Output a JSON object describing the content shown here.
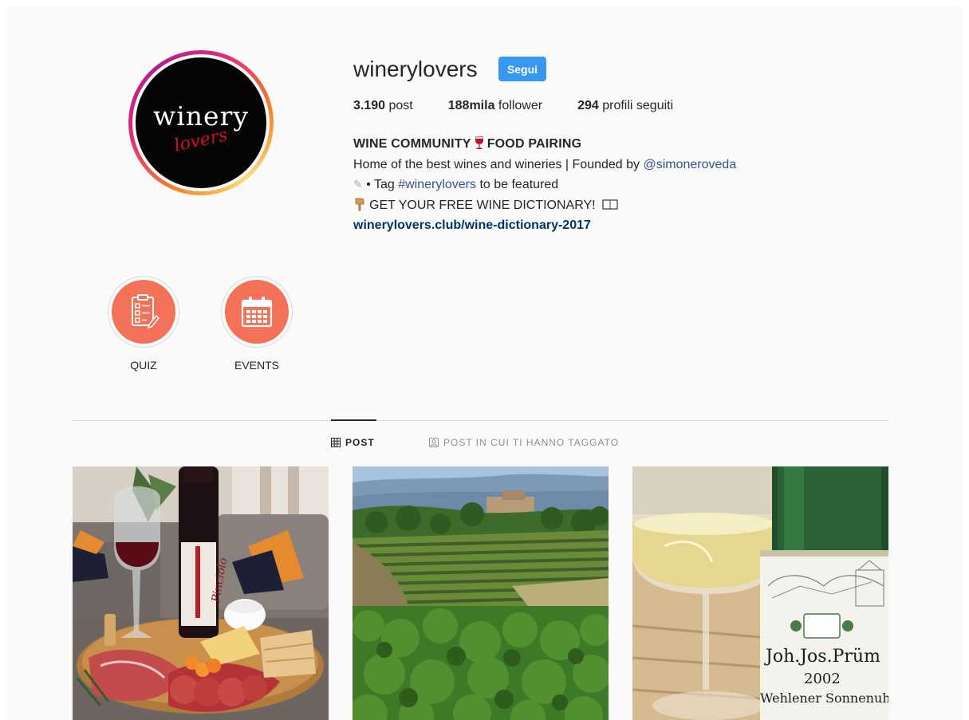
{
  "profile": {
    "username": "winerylovers",
    "follow_label": "Segui",
    "logo_text_top": "winery",
    "logo_text_bottom": "lovers",
    "stats": {
      "posts_value": "3.190",
      "posts_label": "post",
      "followers_value": "188mila",
      "followers_label": "follower",
      "following_value": "294",
      "following_label": "profili seguiti"
    },
    "bio": {
      "name_part1": "WINE COMMUNITY",
      "name_part2": "FOOD PAIRING",
      "line1_text": "Home of the best wines and wineries | Founded by ",
      "line1_mention": "@simoneroveda",
      "line2_prefix": "• Tag ",
      "line2_hashtag": "#winerylovers",
      "line2_suffix": " to be featured",
      "line3_text": "GET YOUR FREE WINE DICTIONARY!",
      "website": "winerylovers.club/wine-dictionary-2017"
    }
  },
  "highlights": [
    {
      "label": "QUIZ",
      "icon": "quiz-document-icon"
    },
    {
      "label": "EVENTS",
      "icon": "calendar-icon"
    }
  ],
  "tabs": {
    "posts_label": "POST",
    "tagged_label": "POST IN CUI TI HANNO TAGGATO"
  },
  "posts": [
    {
      "subject": "charcuterie-board-with-red-wine"
    },
    {
      "subject": "vineyard-landscape"
    },
    {
      "subject": "white-wine-glass-and-bottle",
      "label_text_1": "Joh.Jos.Prüm",
      "label_text_2": "2002",
      "label_text_3": "Wehlener Sonnenuhr"
    }
  ],
  "colors": {
    "accent_blue": "#3897f0",
    "highlight_coral": "#f27157",
    "link_blue": "#385185",
    "url_blue": "#003569"
  }
}
